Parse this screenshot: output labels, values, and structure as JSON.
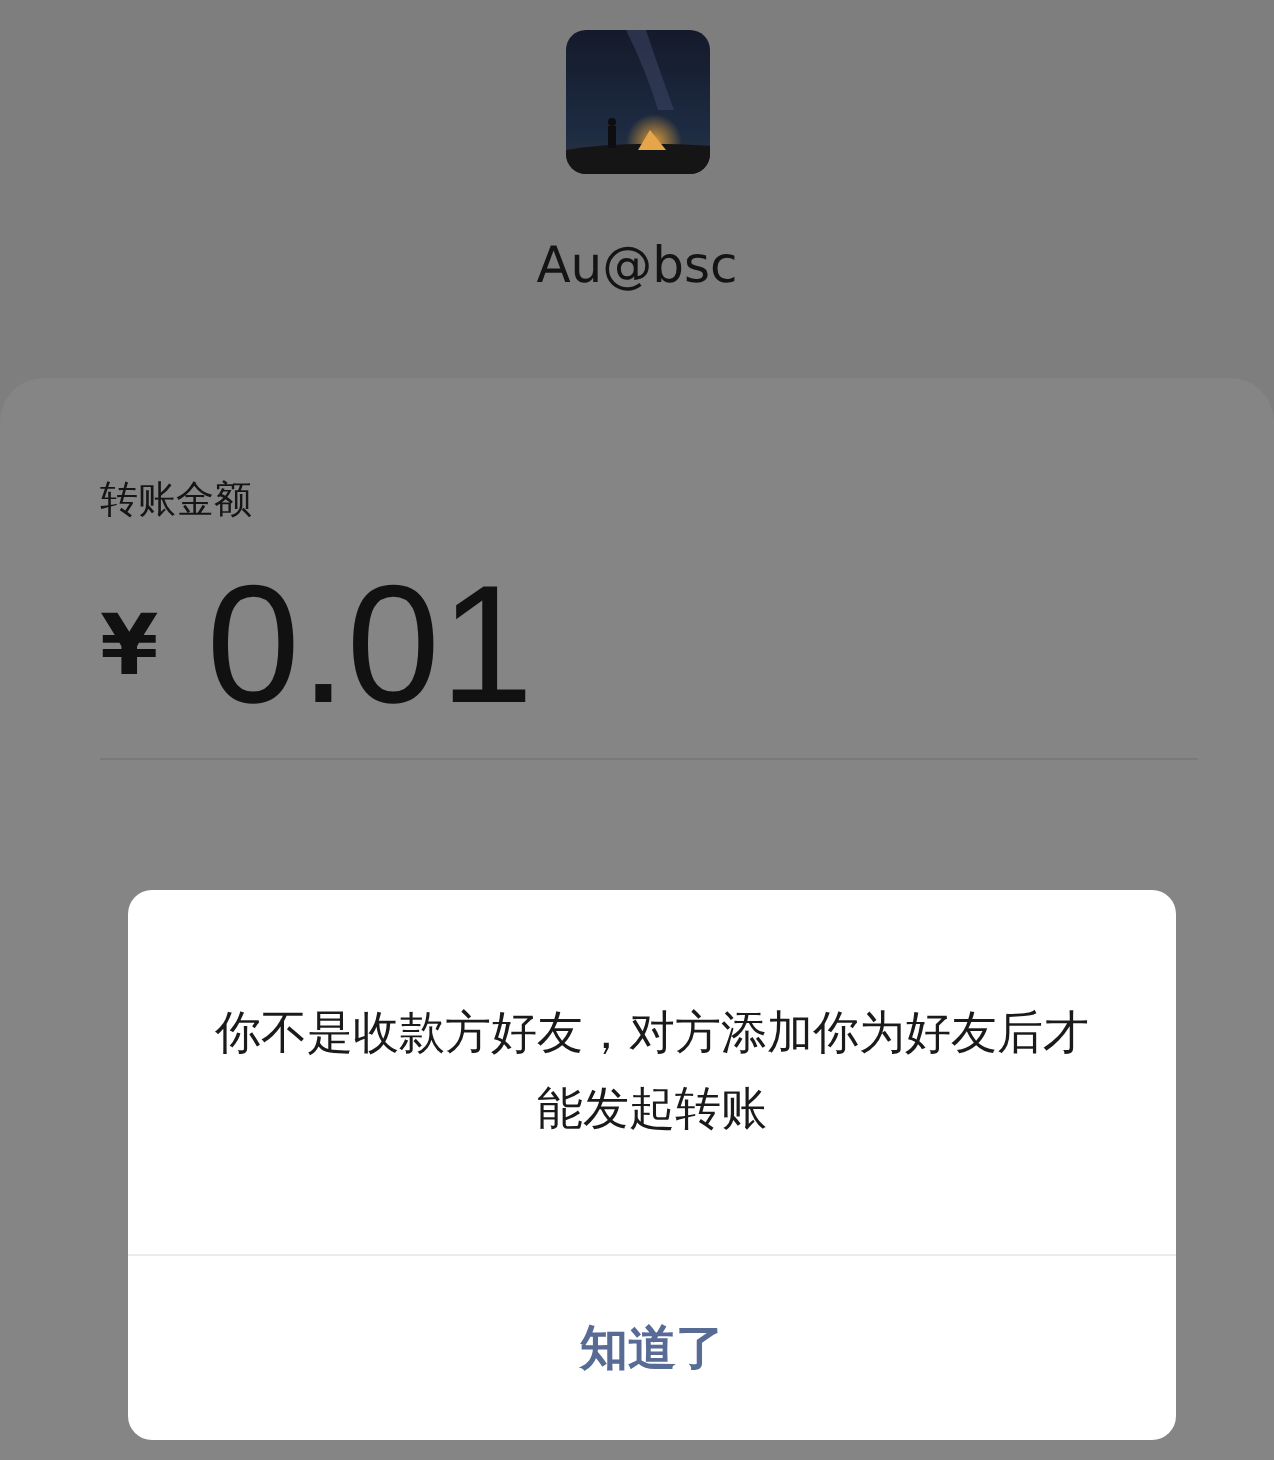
{
  "payee": {
    "name": "Au@bsc"
  },
  "transfer": {
    "label": "转账金额",
    "currency": "¥",
    "amount": "0.01"
  },
  "dialog": {
    "message": "你不是收款方好友，对方添加你为好友后才能发起转账",
    "button": "知道了"
  }
}
